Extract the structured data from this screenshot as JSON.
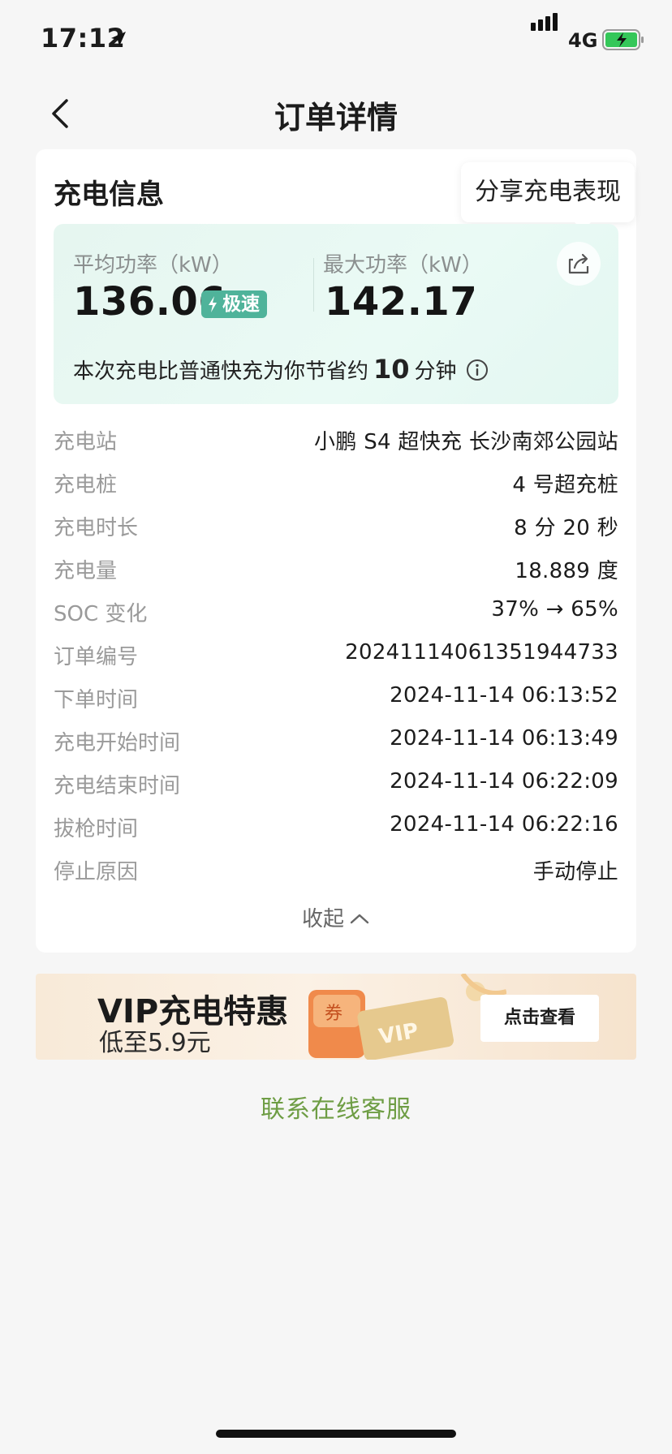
{
  "status_bar": {
    "time": "17:12",
    "network": "4G",
    "icons": [
      "location-arrow-icon",
      "signal-icon",
      "battery-charging-icon"
    ]
  },
  "nav": {
    "title": "订单详情",
    "back_icon": "chevron-left-icon"
  },
  "charging_info": {
    "section_title": "充电信息",
    "share_tooltip": "分享充电表现",
    "avg_power_label": "平均功率（kW）",
    "avg_power_value": "136.06",
    "speed_badge": "极速",
    "max_power_label": "最大功率（kW）",
    "max_power_value": "142.17",
    "saving_prefix": "本次充电比普通快充为你节省约",
    "saving_minutes": "10",
    "saving_suffix": "分钟"
  },
  "details": [
    {
      "label": "充电站",
      "value": "小鹏 S4 超快充 长沙南郊公园站"
    },
    {
      "label": "充电桩",
      "value": "4 号超充桩"
    },
    {
      "label": "充电时长",
      "value": "8 分 20 秒"
    },
    {
      "label": "充电量",
      "value": "18.889 度"
    },
    {
      "label": "SOC 变化",
      "value": "37% → 65%"
    },
    {
      "label": "订单编号",
      "value": "20241114061351944733"
    },
    {
      "label": "下单时间",
      "value": "2024-11-14 06:13:52"
    },
    {
      "label": "充电开始时间",
      "value": "2024-11-14 06:13:49"
    },
    {
      "label": "充电结束时间",
      "value": "2024-11-14 06:22:09"
    },
    {
      "label": "拔枪时间",
      "value": "2024-11-14 06:22:16"
    },
    {
      "label": "停止原因",
      "value": "手动停止"
    }
  ],
  "collapse_label": "收起",
  "banner": {
    "title": "VIP充电特惠",
    "subtitle": "低至5.9元",
    "coupon_text": "券",
    "card_text": "VIP",
    "button": "点击查看"
  },
  "support_link": "联系在线客服",
  "colors": {
    "accent_green": "#4fb39a",
    "link_green": "#6e9d44",
    "panel_bg": "#e6f6f0"
  }
}
